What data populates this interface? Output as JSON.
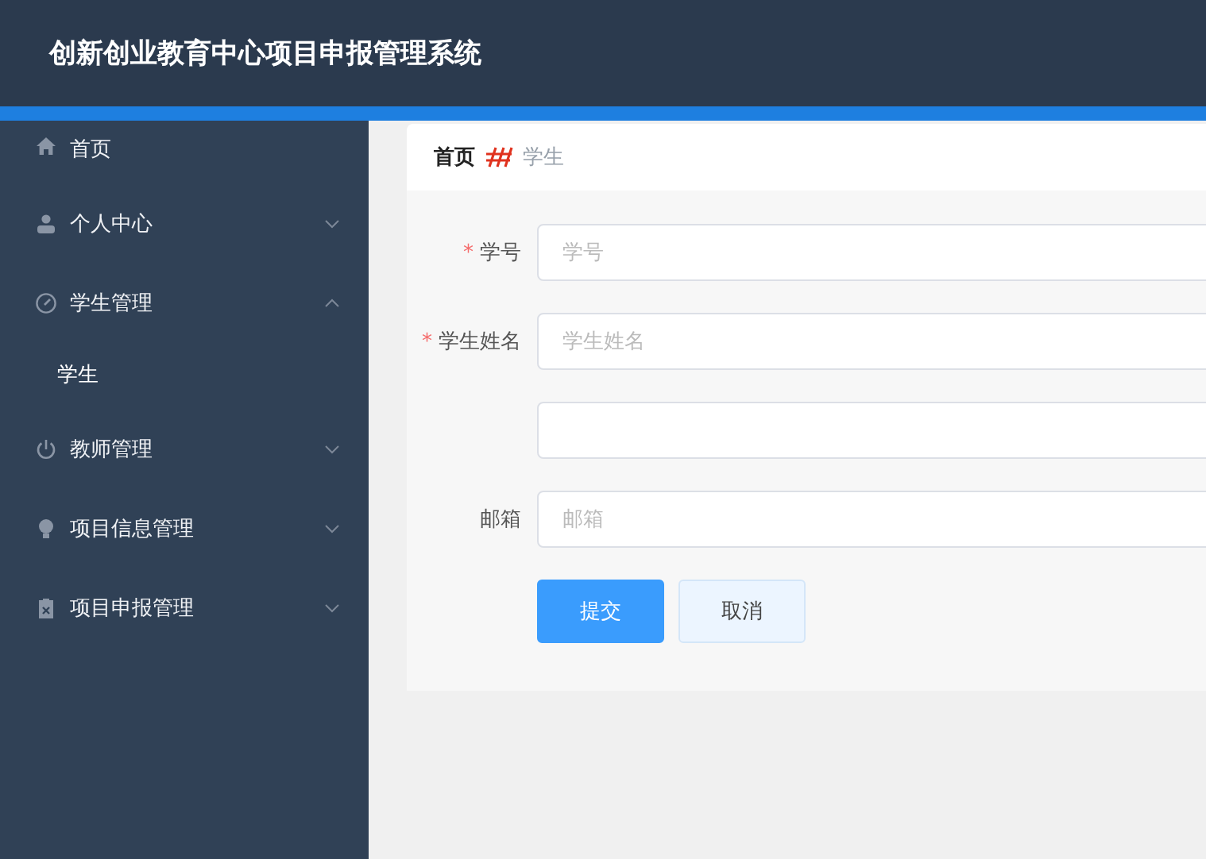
{
  "header": {
    "title": "创新创业教育中心项目申报管理系统"
  },
  "sidebar": {
    "items": [
      {
        "label": "首页"
      },
      {
        "label": "个人中心",
        "has_children": true,
        "expanded": false
      },
      {
        "label": "学生管理",
        "has_children": true,
        "expanded": true,
        "children": [
          {
            "label": "学生"
          }
        ]
      },
      {
        "label": "教师管理",
        "has_children": true,
        "expanded": false
      },
      {
        "label": "项目信息管理",
        "has_children": true,
        "expanded": false
      },
      {
        "label": "项目申报管理",
        "has_children": true,
        "expanded": false
      }
    ]
  },
  "breadcrumb": [
    {
      "label": "首页",
      "current": false
    },
    {
      "label": "学生",
      "current": true
    }
  ],
  "form": {
    "fields": [
      {
        "kind": "input",
        "label": "学号",
        "required_mark": "*",
        "placeholder": "学号"
      },
      {
        "kind": "input",
        "label": "学生姓名",
        "required_mark": "*",
        "placeholder": "学生姓名"
      },
      {
        "kind": "input"
      },
      {
        "kind": "input",
        "label": "邮箱",
        "placeholder": "邮箱"
      }
    ],
    "buttons": [
      {
        "label": "提交",
        "kind": "primary"
      },
      {
        "label": "取消",
        "kind": "default"
      }
    ]
  }
}
